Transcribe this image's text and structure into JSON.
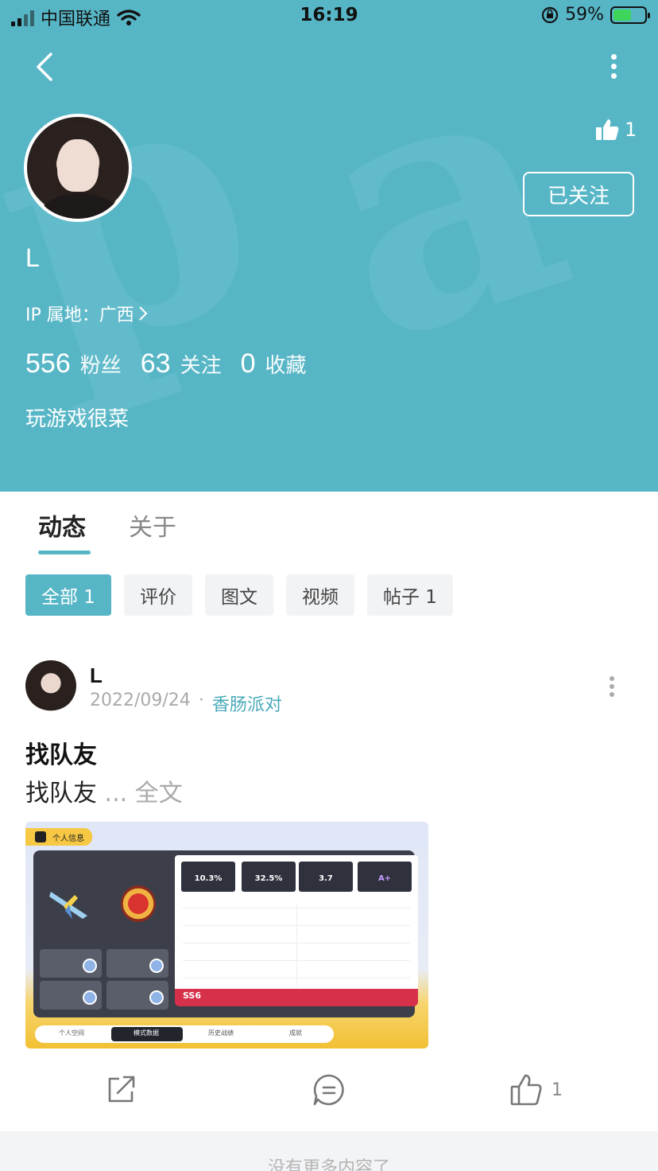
{
  "status_bar": {
    "carrier": "中国联通",
    "time": "16:19",
    "battery_pct": "59%"
  },
  "profile": {
    "likes": "1",
    "follow_button": "已关注",
    "username": "L",
    "ip_label": "IP 属地：广西",
    "stats": [
      {
        "num": "556",
        "label": "粉丝"
      },
      {
        "num": "63",
        "label": "关注"
      },
      {
        "num": "0",
        "label": "收藏"
      }
    ],
    "bio": "玩游戏很菜",
    "header_color": "#57b6c6"
  },
  "tabs": [
    {
      "label": "动态",
      "active": true
    },
    {
      "label": "关于",
      "active": false
    }
  ],
  "filters": [
    {
      "label": "全部 1",
      "active": true
    },
    {
      "label": "评价",
      "active": false
    },
    {
      "label": "图文",
      "active": false
    },
    {
      "label": "视频",
      "active": false
    },
    {
      "label": "帖子 1",
      "active": false
    }
  ],
  "post": {
    "author": "L",
    "date": "2022/09/24",
    "separator": "·",
    "game": "香肠派对",
    "title": "找队友",
    "body": "找队友",
    "more": "... 全文",
    "like_count": "1",
    "image": {
      "tag": "个人信息",
      "cards": [
        "10.3%",
        "32.5%",
        "3.7",
        "A+"
      ],
      "tabs": [
        "个人空间",
        "模式数据",
        "历史战绩",
        "成就"
      ],
      "season": "SS6"
    }
  },
  "footer": {
    "text": "没有更多内容了"
  }
}
